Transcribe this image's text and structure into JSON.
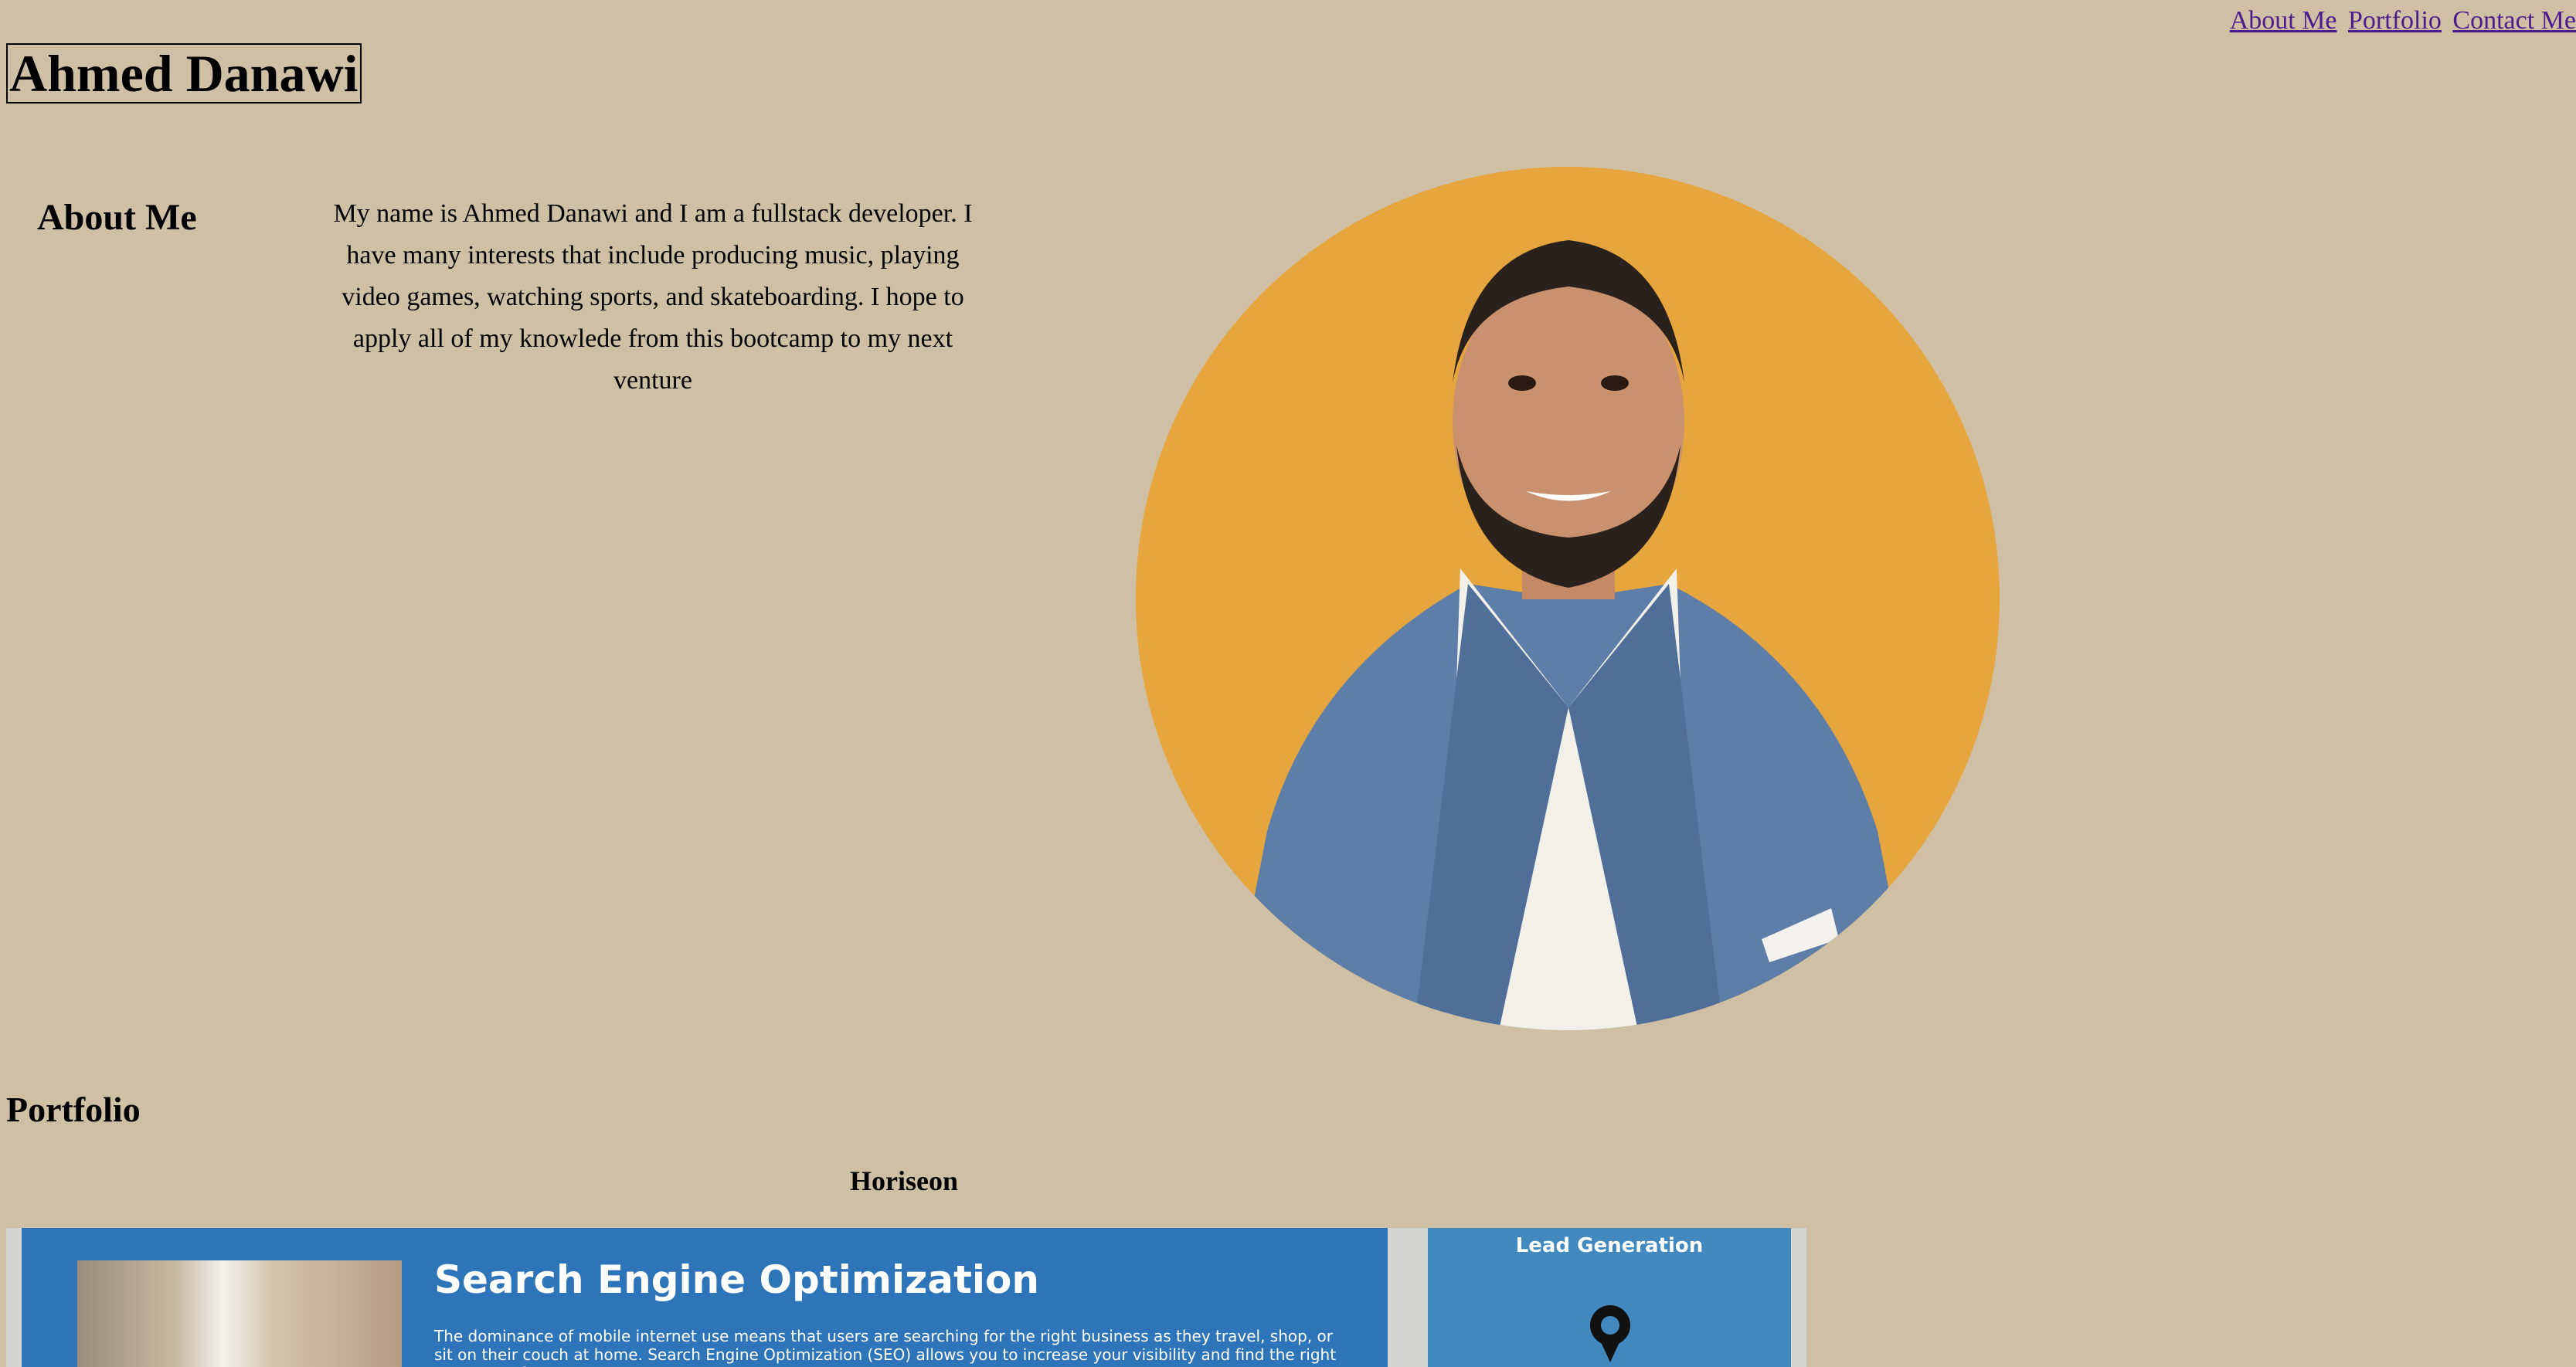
{
  "nav": {
    "links": [
      "About Me",
      "Portfolio",
      "Contact Me"
    ]
  },
  "header": {
    "title": "Ahmed Danawi"
  },
  "about": {
    "heading": "About Me",
    "text": "My name is Ahmed Danawi and I am a fullstack developer. I have many interests that include producing music, playing video games, watching sports, and skateboarding. I hope to apply all of my knowlede from this bootcamp to my next venture"
  },
  "portfolio": {
    "heading": "Portfolio",
    "project": {
      "title": "Horiseon",
      "screenshot": {
        "seo_heading": "Search Engine Optimization",
        "seo_body": "The dominance of mobile internet use means that users are searching for the right business as they travel, shop, or sit on their couch at home. Search Engine Optimization (SEO) allows you to increase your visibility and find the right customers for your",
        "lead_heading": "Lead Generation"
      }
    }
  },
  "colors": {
    "page_background": "#cfc0a5",
    "link": "#4b1c8c",
    "portrait_background": "#e6a53d",
    "seo_panel": "#2e74b8",
    "lead_panel": "#4189bf"
  }
}
